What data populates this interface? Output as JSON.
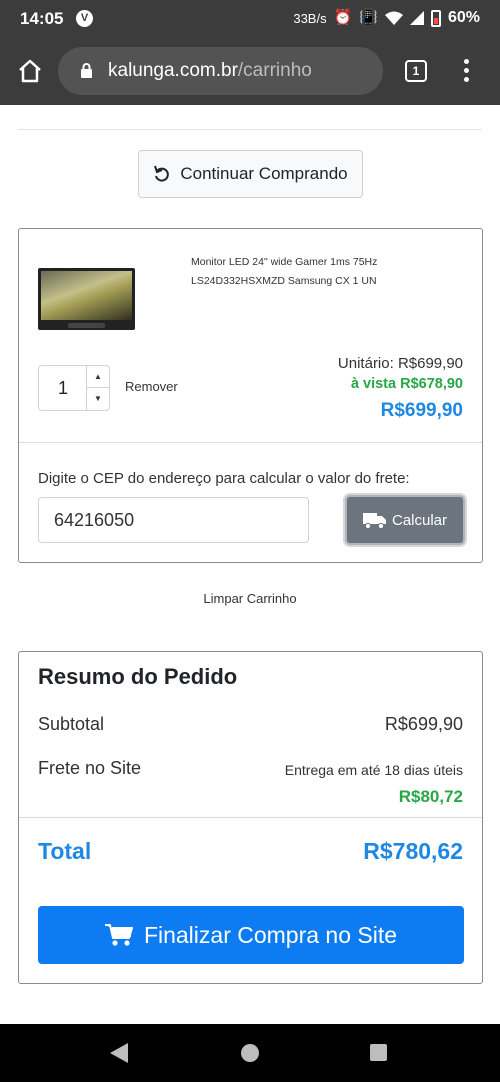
{
  "status_bar": {
    "time": "14:05",
    "app_badge": "V",
    "network_speed": "33B/s",
    "battery_percent": "60%"
  },
  "browser": {
    "url_domain": "kalunga.com.br",
    "url_path": "/carrinho",
    "tab_count": "1"
  },
  "cart": {
    "continue_label": "Continuar Comprando",
    "product": {
      "name": "Monitor LED 24\" wide Gamer 1ms 75Hz LS24D332HSXMZD Samsung CX 1 UN",
      "quantity": "1",
      "remove_label": "Remover",
      "unit_price": "Unitário: R$699,90",
      "cash_price": "à vista R$678,90",
      "total": "R$699,90"
    },
    "shipping": {
      "cep_label": "Digite o CEP do endereço para calcular o valor do frete:",
      "cep_value": "64216050",
      "calculate_label": "Calcular"
    },
    "clear_label": "Limpar Carrinho"
  },
  "summary": {
    "title": "Resumo do Pedido",
    "subtotal_label": "Subtotal",
    "subtotal_value": "R$699,90",
    "shipping_label": "Frete no Site",
    "shipping_note": "Entrega em até 18 dias úteis",
    "shipping_value": "R$80,72",
    "total_label": "Total",
    "total_value": "R$780,62",
    "checkout_label": "Finalizar Compra no Site"
  },
  "colors": {
    "accent_blue": "#1e88e5",
    "button_blue": "#0d7cf2",
    "green": "#28a745",
    "browser_chrome": "#3c3c3c"
  },
  "icons": [
    "v-app-icon",
    "alarm-icon",
    "vibrate-icon",
    "wifi-icon",
    "signal-icon",
    "battery-icon",
    "home-icon",
    "lock-icon",
    "tabs-icon",
    "overflow-menu-icon",
    "undo-icon",
    "truck-icon",
    "cart-icon",
    "back-icon",
    "home-circle-icon",
    "recents-icon"
  ]
}
